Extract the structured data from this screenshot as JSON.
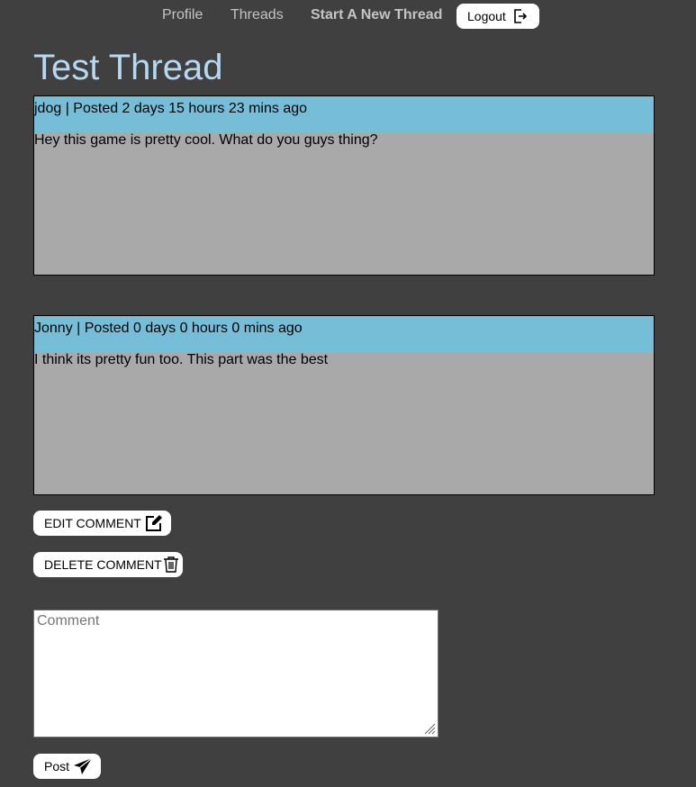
{
  "nav": {
    "profile": "Profile",
    "threads": "Threads",
    "new_thread": "Start A New Thread",
    "logout": "Logout"
  },
  "thread": {
    "title": "Test Thread"
  },
  "posts": [
    {
      "header": "jdog | Posted 2 days 15 hours 23 mins ago",
      "body": "Hey this game is pretty cool. What do you guys thing?"
    },
    {
      "header": "Jonny | Posted 0 days 0 hours 0 mins ago",
      "body": "I think its pretty fun too. This part was the best"
    }
  ],
  "actions": {
    "edit": "EDIT COMMENT",
    "delete": "DELETE COMMENT"
  },
  "comment_form": {
    "placeholder": "Comment",
    "value": "",
    "post_label": "Post"
  },
  "icons": {
    "logout": "logout-icon",
    "edit": "edit-icon",
    "delete": "trash-icon",
    "post": "send-icon"
  },
  "colors": {
    "background": "#404040",
    "title": "#b5d9f2",
    "post_header": "#76bed8",
    "post_body": "#a9a9a9",
    "nav_text": "#c4c4c4"
  }
}
